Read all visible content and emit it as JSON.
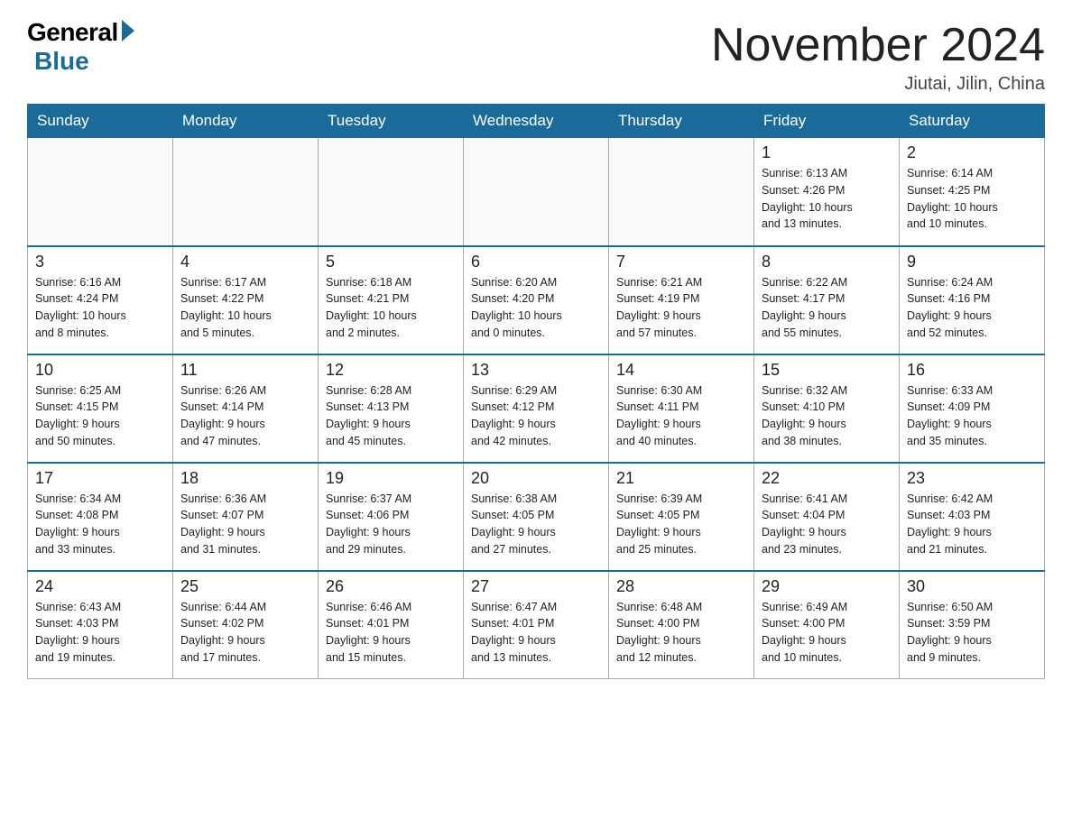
{
  "logo": {
    "general": "General",
    "blue": "Blue"
  },
  "title": "November 2024",
  "location": "Jiutai, Jilin, China",
  "weekdays": [
    "Sunday",
    "Monday",
    "Tuesday",
    "Wednesday",
    "Thursday",
    "Friday",
    "Saturday"
  ],
  "weeks": [
    [
      {
        "day": "",
        "info": ""
      },
      {
        "day": "",
        "info": ""
      },
      {
        "day": "",
        "info": ""
      },
      {
        "day": "",
        "info": ""
      },
      {
        "day": "",
        "info": ""
      },
      {
        "day": "1",
        "info": "Sunrise: 6:13 AM\nSunset: 4:26 PM\nDaylight: 10 hours\nand 13 minutes."
      },
      {
        "day": "2",
        "info": "Sunrise: 6:14 AM\nSunset: 4:25 PM\nDaylight: 10 hours\nand 10 minutes."
      }
    ],
    [
      {
        "day": "3",
        "info": "Sunrise: 6:16 AM\nSunset: 4:24 PM\nDaylight: 10 hours\nand 8 minutes."
      },
      {
        "day": "4",
        "info": "Sunrise: 6:17 AM\nSunset: 4:22 PM\nDaylight: 10 hours\nand 5 minutes."
      },
      {
        "day": "5",
        "info": "Sunrise: 6:18 AM\nSunset: 4:21 PM\nDaylight: 10 hours\nand 2 minutes."
      },
      {
        "day": "6",
        "info": "Sunrise: 6:20 AM\nSunset: 4:20 PM\nDaylight: 10 hours\nand 0 minutes."
      },
      {
        "day": "7",
        "info": "Sunrise: 6:21 AM\nSunset: 4:19 PM\nDaylight: 9 hours\nand 57 minutes."
      },
      {
        "day": "8",
        "info": "Sunrise: 6:22 AM\nSunset: 4:17 PM\nDaylight: 9 hours\nand 55 minutes."
      },
      {
        "day": "9",
        "info": "Sunrise: 6:24 AM\nSunset: 4:16 PM\nDaylight: 9 hours\nand 52 minutes."
      }
    ],
    [
      {
        "day": "10",
        "info": "Sunrise: 6:25 AM\nSunset: 4:15 PM\nDaylight: 9 hours\nand 50 minutes."
      },
      {
        "day": "11",
        "info": "Sunrise: 6:26 AM\nSunset: 4:14 PM\nDaylight: 9 hours\nand 47 minutes."
      },
      {
        "day": "12",
        "info": "Sunrise: 6:28 AM\nSunset: 4:13 PM\nDaylight: 9 hours\nand 45 minutes."
      },
      {
        "day": "13",
        "info": "Sunrise: 6:29 AM\nSunset: 4:12 PM\nDaylight: 9 hours\nand 42 minutes."
      },
      {
        "day": "14",
        "info": "Sunrise: 6:30 AM\nSunset: 4:11 PM\nDaylight: 9 hours\nand 40 minutes."
      },
      {
        "day": "15",
        "info": "Sunrise: 6:32 AM\nSunset: 4:10 PM\nDaylight: 9 hours\nand 38 minutes."
      },
      {
        "day": "16",
        "info": "Sunrise: 6:33 AM\nSunset: 4:09 PM\nDaylight: 9 hours\nand 35 minutes."
      }
    ],
    [
      {
        "day": "17",
        "info": "Sunrise: 6:34 AM\nSunset: 4:08 PM\nDaylight: 9 hours\nand 33 minutes."
      },
      {
        "day": "18",
        "info": "Sunrise: 6:36 AM\nSunset: 4:07 PM\nDaylight: 9 hours\nand 31 minutes."
      },
      {
        "day": "19",
        "info": "Sunrise: 6:37 AM\nSunset: 4:06 PM\nDaylight: 9 hours\nand 29 minutes."
      },
      {
        "day": "20",
        "info": "Sunrise: 6:38 AM\nSunset: 4:05 PM\nDaylight: 9 hours\nand 27 minutes."
      },
      {
        "day": "21",
        "info": "Sunrise: 6:39 AM\nSunset: 4:05 PM\nDaylight: 9 hours\nand 25 minutes."
      },
      {
        "day": "22",
        "info": "Sunrise: 6:41 AM\nSunset: 4:04 PM\nDaylight: 9 hours\nand 23 minutes."
      },
      {
        "day": "23",
        "info": "Sunrise: 6:42 AM\nSunset: 4:03 PM\nDaylight: 9 hours\nand 21 minutes."
      }
    ],
    [
      {
        "day": "24",
        "info": "Sunrise: 6:43 AM\nSunset: 4:03 PM\nDaylight: 9 hours\nand 19 minutes."
      },
      {
        "day": "25",
        "info": "Sunrise: 6:44 AM\nSunset: 4:02 PM\nDaylight: 9 hours\nand 17 minutes."
      },
      {
        "day": "26",
        "info": "Sunrise: 6:46 AM\nSunset: 4:01 PM\nDaylight: 9 hours\nand 15 minutes."
      },
      {
        "day": "27",
        "info": "Sunrise: 6:47 AM\nSunset: 4:01 PM\nDaylight: 9 hours\nand 13 minutes."
      },
      {
        "day": "28",
        "info": "Sunrise: 6:48 AM\nSunset: 4:00 PM\nDaylight: 9 hours\nand 12 minutes."
      },
      {
        "day": "29",
        "info": "Sunrise: 6:49 AM\nSunset: 4:00 PM\nDaylight: 9 hours\nand 10 minutes."
      },
      {
        "day": "30",
        "info": "Sunrise: 6:50 AM\nSunset: 3:59 PM\nDaylight: 9 hours\nand 9 minutes."
      }
    ]
  ]
}
